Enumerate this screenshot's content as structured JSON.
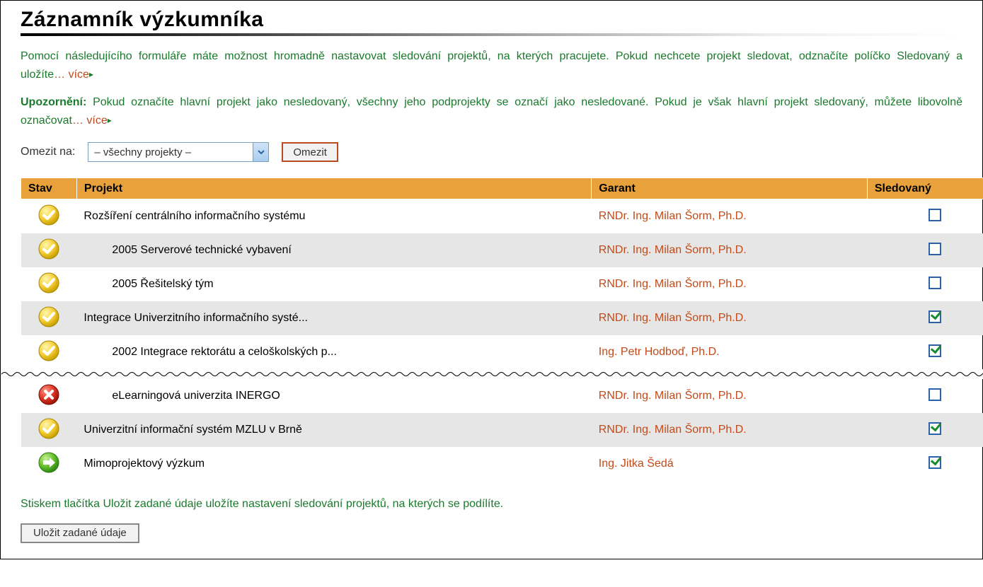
{
  "title": "Záznamník výzkumníka",
  "intro_text": "Pomocí následujícího formuláře máte možnost hromadně nastavovat sledování projektů, na kterých pracujete. Pokud nechcete projekt sledovat, odznačíte políčko Sledovaný a uložíte",
  "warn_label": "Upozornění:",
  "warn_text": " Pokud označíte hlavní projekt jako nesledovaný, všechny jeho podprojekty se označí jako nesledované. Pokud je však hlavní projekt sledovaný, můžete libovolně označovat",
  "more_label": "… více",
  "filter": {
    "label": "Omezit na:",
    "selected": "– všechny projekty –",
    "button": "Omezit"
  },
  "columns": {
    "stav": "Stav",
    "projekt": "Projekt",
    "garant": "Garant",
    "sledovany": "Sledovaný"
  },
  "rows": [
    {
      "status": "ok",
      "indent": 0,
      "projekt": "Rozšíření centrálního informačního systému",
      "garant": "RNDr. Ing. Milan Šorm, Ph.D.",
      "checked": false,
      "alt": false
    },
    {
      "status": "ok",
      "indent": 1,
      "projekt": "2005 Serverové technické vybavení",
      "garant": "RNDr. Ing. Milan Šorm, Ph.D.",
      "checked": false,
      "alt": true
    },
    {
      "status": "ok",
      "indent": 1,
      "projekt": "2005 Řešitelský tým",
      "garant": "RNDr. Ing. Milan Šorm, Ph.D.",
      "checked": false,
      "alt": false
    },
    {
      "status": "ok",
      "indent": 0,
      "projekt": "Integrace Univerzitního informačního systé...",
      "garant": "RNDr. Ing. Milan Šorm, Ph.D.",
      "checked": true,
      "alt": true
    },
    {
      "status": "ok",
      "indent": 1,
      "projekt": "2002 Integrace rektorátu a celoškolských p...",
      "garant": "Ing. Petr Hodboď, Ph.D.",
      "checked": true,
      "alt": false
    },
    {
      "status": "wavy"
    },
    {
      "status": "err",
      "indent": 1,
      "projekt": "eLearningová univerzita INERGO",
      "garant": "RNDr. Ing. Milan Šorm, Ph.D.",
      "checked": false,
      "alt": false
    },
    {
      "status": "ok",
      "indent": 0,
      "projekt": "Univerzitní informační systém MZLU v Brně",
      "garant": "RNDr. Ing. Milan Šorm, Ph.D.",
      "checked": true,
      "alt": true
    },
    {
      "status": "arrow",
      "indent": 0,
      "projekt": "Mimoprojektový výzkum",
      "garant": "Ing. Jitka Šedá",
      "checked": true,
      "alt": false
    }
  ],
  "note": "Stiskem tlačítka Uložit zadané údaje uložíte nastavení sledování projektů, na kterých se podílíte.",
  "save_button": "Uložit zadané údaje"
}
